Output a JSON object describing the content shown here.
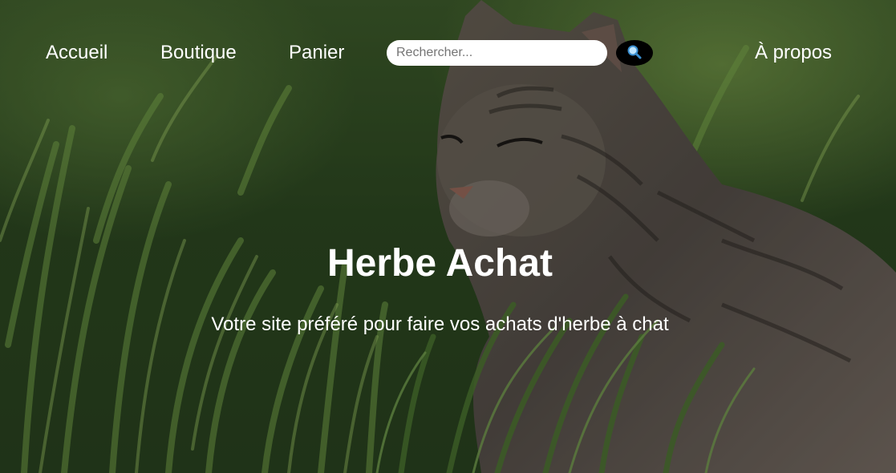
{
  "nav": {
    "items": [
      {
        "label": "Accueil"
      },
      {
        "label": "Boutique"
      },
      {
        "label": "Panier"
      }
    ],
    "about_label": "À propos"
  },
  "search": {
    "placeholder": "Rechercher...",
    "value": "",
    "button_icon": "search-icon"
  },
  "hero": {
    "title": "Herbe Achat",
    "subtitle": "Votre site préféré pour faire vos achats d'herbe à chat",
    "background_image": "tabby cat sitting in green grass"
  },
  "colors": {
    "text": "#ffffff",
    "search_button": "#000000",
    "search_field": "#ffffff",
    "grass": "#3f5e2c"
  }
}
